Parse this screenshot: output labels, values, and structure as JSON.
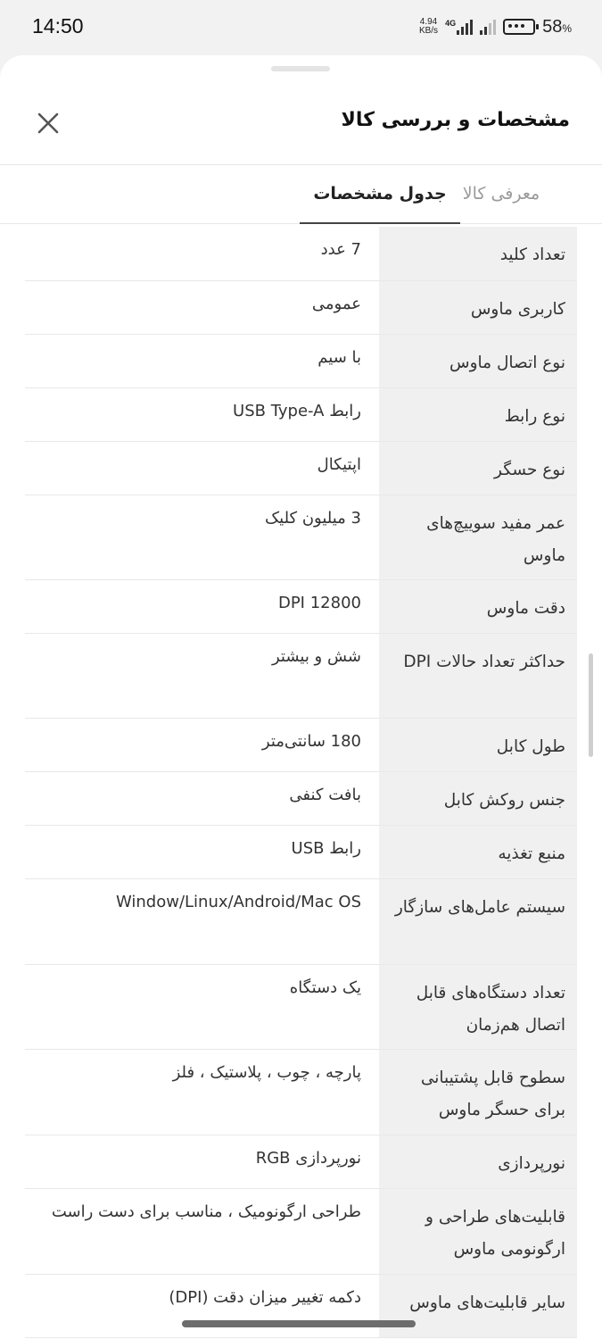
{
  "status_bar": {
    "time": "14:50",
    "net_speed_value": "4.94",
    "net_speed_unit": "KB/s",
    "network_type": "4G",
    "battery_percent": "58",
    "battery_symbol": "%"
  },
  "sheet": {
    "title": "مشخصات و بررسی کالا",
    "close_icon": "close-icon"
  },
  "tabs": {
    "intro": "معرفی کالا",
    "specs": "جدول مشخصات",
    "active": "specs"
  },
  "specs": [
    {
      "label": "تعداد کلید",
      "value": "7 عدد"
    },
    {
      "label": "کاربری ماوس",
      "value": "عمومی"
    },
    {
      "label": "نوع اتصال ماوس",
      "value": "با سیم"
    },
    {
      "label": "نوع رابط",
      "value": "رابط USB Type-A"
    },
    {
      "label": "نوع حسگر",
      "value": "اپتیکال"
    },
    {
      "label": "عمر مفید سوییچ‌های ماوس",
      "value": "3 میلیون کلیک"
    },
    {
      "label": "دقت ماوس",
      "value": "12800 DPI"
    },
    {
      "label": "حداکثر تعداد حالات DPI",
      "value": "شش و بیشتر"
    },
    {
      "label": "طول کابل",
      "value": "180 سانتی‌متر"
    },
    {
      "label": "جنس روکش کابل",
      "value": "بافت کنفی"
    },
    {
      "label": "منبع تغذیه",
      "value": "رابط USB"
    },
    {
      "label": "سیستم عامل‌های سازگار",
      "value": "Window/Linux/Android/Mac OS"
    },
    {
      "label": "تعداد دستگاه‌های قابل اتصال هم‌زمان",
      "value": "یک دستگاه"
    },
    {
      "label": "سطوح قابل پشتیبانی برای حسگر ماوس",
      "value": "پارچه ، چوب ، پلاستیک ، فلز"
    },
    {
      "label": "نورپردازی",
      "value": "نورپردازی RGB"
    },
    {
      "label": "قابلیت‌های طراحی و ارگونومی ماوس",
      "value": "طراحی ارگونومیک ، مناسب برای دست راست"
    },
    {
      "label": "سایر قابلیت‌های ماوس",
      "value": "دکمه تغییر میزان دقت (DPI)"
    }
  ]
}
